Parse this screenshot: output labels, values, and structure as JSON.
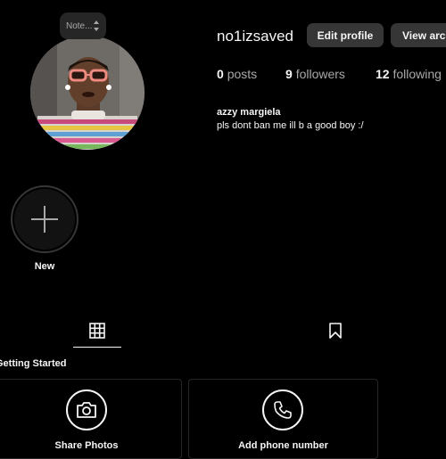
{
  "note": {
    "text": "Note..."
  },
  "profile": {
    "username": "no1izsaved",
    "edit_label": "Edit profile",
    "archive_label": "View archive",
    "stats": {
      "posts_count": "0",
      "posts_label": "posts",
      "followers_count": "9",
      "followers_label": "followers",
      "following_count": "12",
      "following_label": "following"
    },
    "full_name": "azzy margiela",
    "bio": "pls dont ban me ill b a good boy :/"
  },
  "highlights": {
    "new_label": "New"
  },
  "tabs": {
    "active": "posts-grid"
  },
  "getting_started": {
    "title": "Getting Started",
    "cards": [
      {
        "icon": "camera-icon",
        "label": "Share Photos"
      },
      {
        "icon": "phone-icon",
        "label": "Add phone number"
      }
    ]
  },
  "colors": {
    "background": "#000000",
    "text": "#f5f5f5",
    "muted": "#a8a8a8",
    "button": "#363636"
  }
}
